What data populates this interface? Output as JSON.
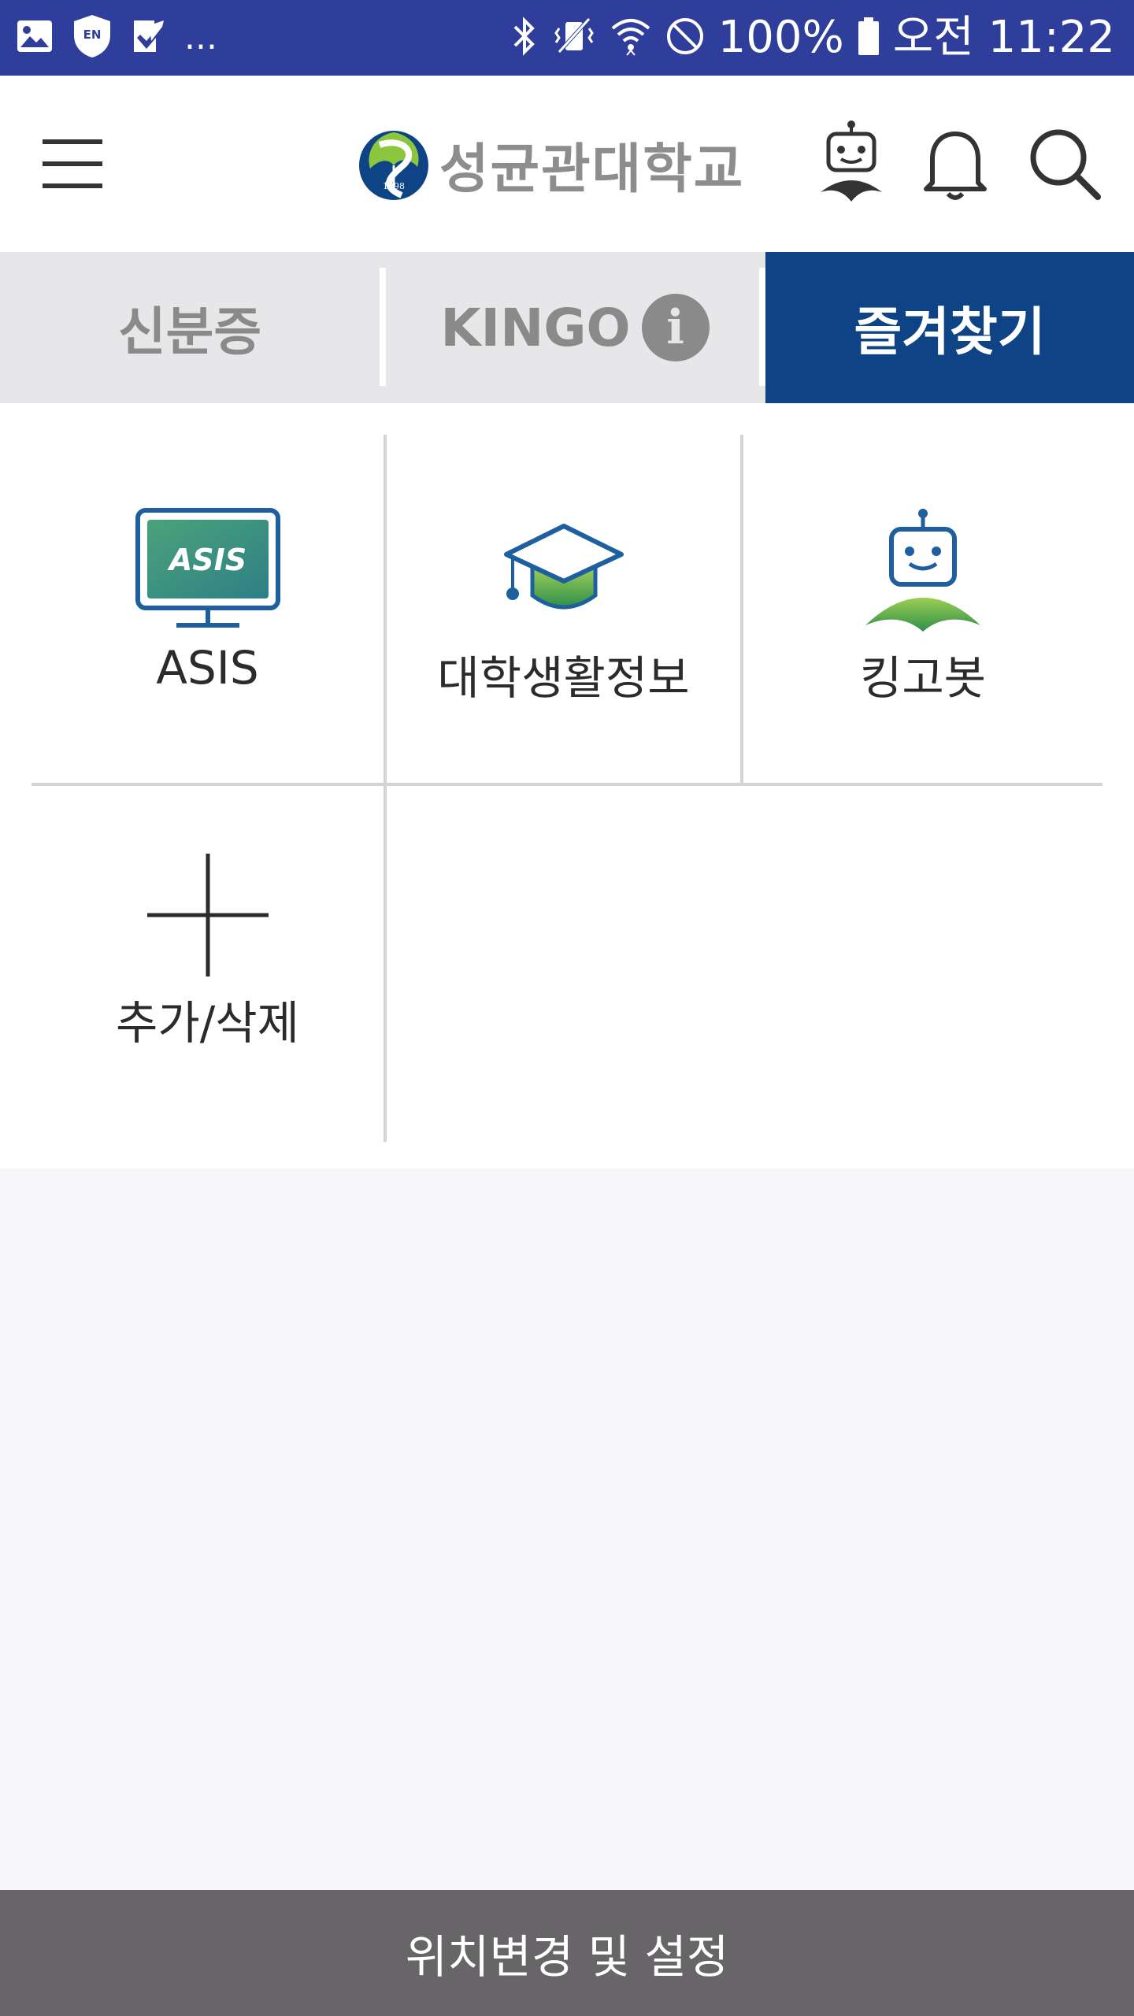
{
  "status_bar": {
    "left_icons": [
      "gallery-icon",
      "vpn-shield-icon",
      "task-check-icon"
    ],
    "overflow": "...",
    "right_icons": [
      "bluetooth-icon",
      "vibrate-icon",
      "wifi-icon",
      "do-not-disturb-icon"
    ],
    "battery": "100%",
    "time": "오전 11:22"
  },
  "header": {
    "logo_text": "성균관대학교",
    "logo_year": "1398",
    "icons": [
      "menu-icon",
      "kingobot-icon",
      "bell-icon",
      "search-icon"
    ]
  },
  "tabs": [
    {
      "label": "신분증",
      "active": false
    },
    {
      "label": "KINGO",
      "badge": "i",
      "active": false
    },
    {
      "label": "즐겨찾기",
      "active": true
    }
  ],
  "favorites": [
    {
      "label": "ASIS",
      "icon": "asis-monitor-icon",
      "screen_text": "ASIS"
    },
    {
      "label": "대학생활정보",
      "icon": "graduation-cap-icon"
    },
    {
      "label": "킹고봇",
      "icon": "kingobot-icon"
    },
    {
      "label": "추가/삭제",
      "icon": "plus-icon"
    }
  ],
  "bottom_bar": {
    "label": "위치변경 및 설정"
  },
  "colors": {
    "status_bar": "#2f3e9a",
    "active_tab": "#0e4485",
    "inactive_tab": "#e7e6e9",
    "bottom_bar": "#676567",
    "background": "#f6f5f7"
  }
}
